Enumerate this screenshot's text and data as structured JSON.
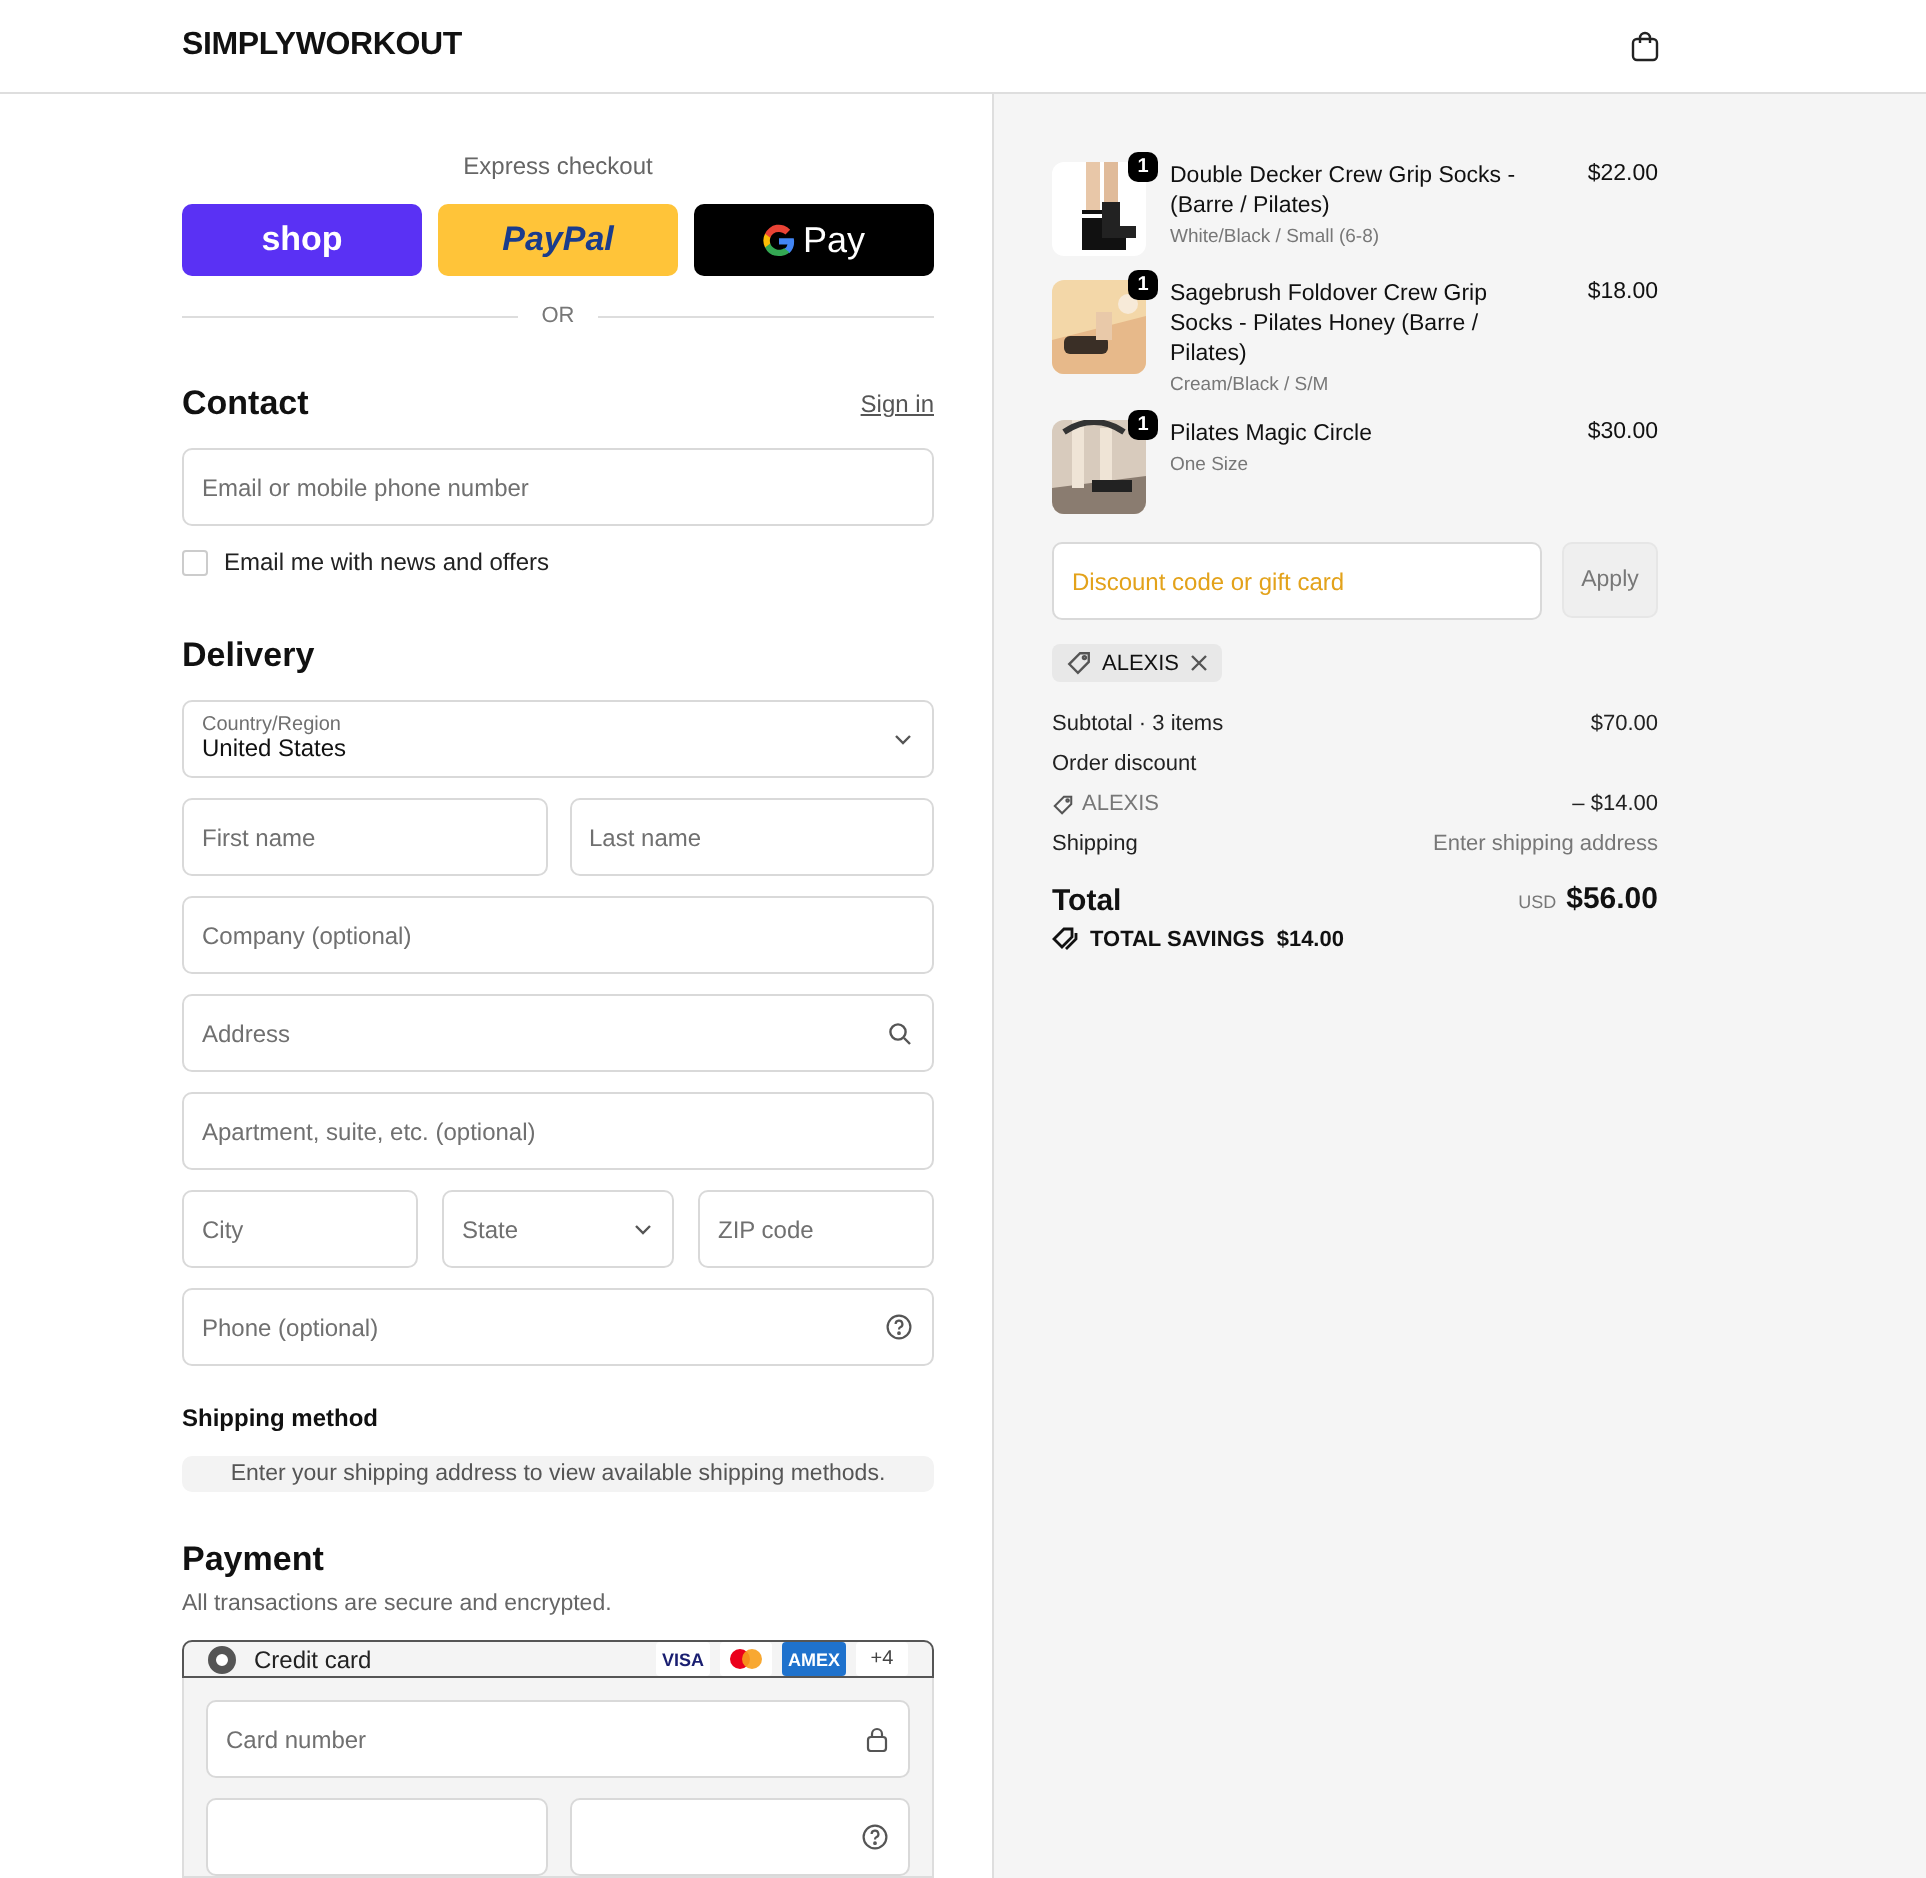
{
  "header": {
    "brand": "SIMPLYWORKOUT"
  },
  "express": {
    "title": "Express checkout",
    "divider": "OR",
    "buttons": [
      {
        "kind": "shop",
        "label": "shop"
      },
      {
        "kind": "paypal",
        "label": "PayPal"
      },
      {
        "kind": "gpay",
        "label": "Pay"
      }
    ]
  },
  "contact": {
    "title": "Contact",
    "sign_in": "Sign in",
    "email": {
      "placeholder": "Email or mobile phone number"
    },
    "newsletter": {
      "label": "Email me with news and offers",
      "checked": false
    }
  },
  "delivery": {
    "title": "Delivery",
    "rows": [
      [
        {
          "kind": "select",
          "label": "Country/Region",
          "value": "United States"
        }
      ],
      [
        {
          "kind": "text",
          "placeholder": "First name"
        },
        {
          "kind": "text",
          "placeholder": "Last name"
        }
      ],
      [
        {
          "kind": "text",
          "placeholder": "Company (optional)"
        }
      ],
      [
        {
          "kind": "search",
          "placeholder": "Address"
        }
      ],
      [
        {
          "kind": "text",
          "placeholder": "Apartment, suite, etc. (optional)"
        }
      ],
      [
        {
          "kind": "text",
          "placeholder": "City"
        },
        {
          "kind": "select",
          "placeholder": "State"
        },
        {
          "kind": "text",
          "placeholder": "ZIP code"
        }
      ],
      [
        {
          "kind": "help",
          "placeholder": "Phone (optional)"
        }
      ]
    ]
  },
  "shipping_method": {
    "title": "Shipping method",
    "notice": "Enter your shipping address to view available shipping methods."
  },
  "payment": {
    "title": "Payment",
    "subtitle": "All transactions are secure and encrypted.",
    "methods": [
      {
        "label": "Credit card",
        "selected": true,
        "cards": [
          {
            "kind": "visa",
            "label": "VISA"
          },
          {
            "kind": "mastercard"
          },
          {
            "kind": "amex",
            "label": "AMEX"
          },
          {
            "kind": "more",
            "label": "+4"
          }
        ],
        "fields": [
          [
            {
              "kind": "lock",
              "placeholder": "Card number"
            }
          ],
          [
            {
              "kind": "text"
            },
            {
              "kind": "help"
            }
          ]
        ]
      }
    ]
  },
  "cart": {
    "items": [
      {
        "quantity": "1",
        "name": "Double Decker Crew Grip Socks - (Barre / Pilates)",
        "variant": "White/Black / Small (6-8)",
        "price": "$22.00",
        "kind": "picture"
      },
      {
        "quantity": "1",
        "name": "Sagebrush Foldover Crew Grip Socks - Pilates Honey (Barre / Pilates)",
        "variant": "Cream/Black / S/M",
        "price": "$18.00",
        "kind": "picture"
      },
      {
        "quantity": "1",
        "name": "Pilates Magic Circle",
        "variant": "One Size",
        "price": "$30.00",
        "kind": "picture"
      }
    ],
    "discount": {
      "placeholder": "Discount code or gift card",
      "apply": "Apply"
    },
    "applied_code": "ALEXIS",
    "summary": [
      {
        "kind": "line",
        "label": "Subtotal · 3 items",
        "value": "$70.00"
      },
      {
        "kind": "heading",
        "label": "Order discount"
      },
      {
        "kind": "code",
        "label": "ALEXIS",
        "value": "– $14.00"
      },
      {
        "kind": "muted",
        "label": "Shipping",
        "value": "Enter shipping address"
      }
    ],
    "total": {
      "label": "Total",
      "currency": "USD",
      "value": "$56.00"
    },
    "savings": {
      "label": "TOTAL SAVINGS",
      "value": "$14.00"
    }
  }
}
